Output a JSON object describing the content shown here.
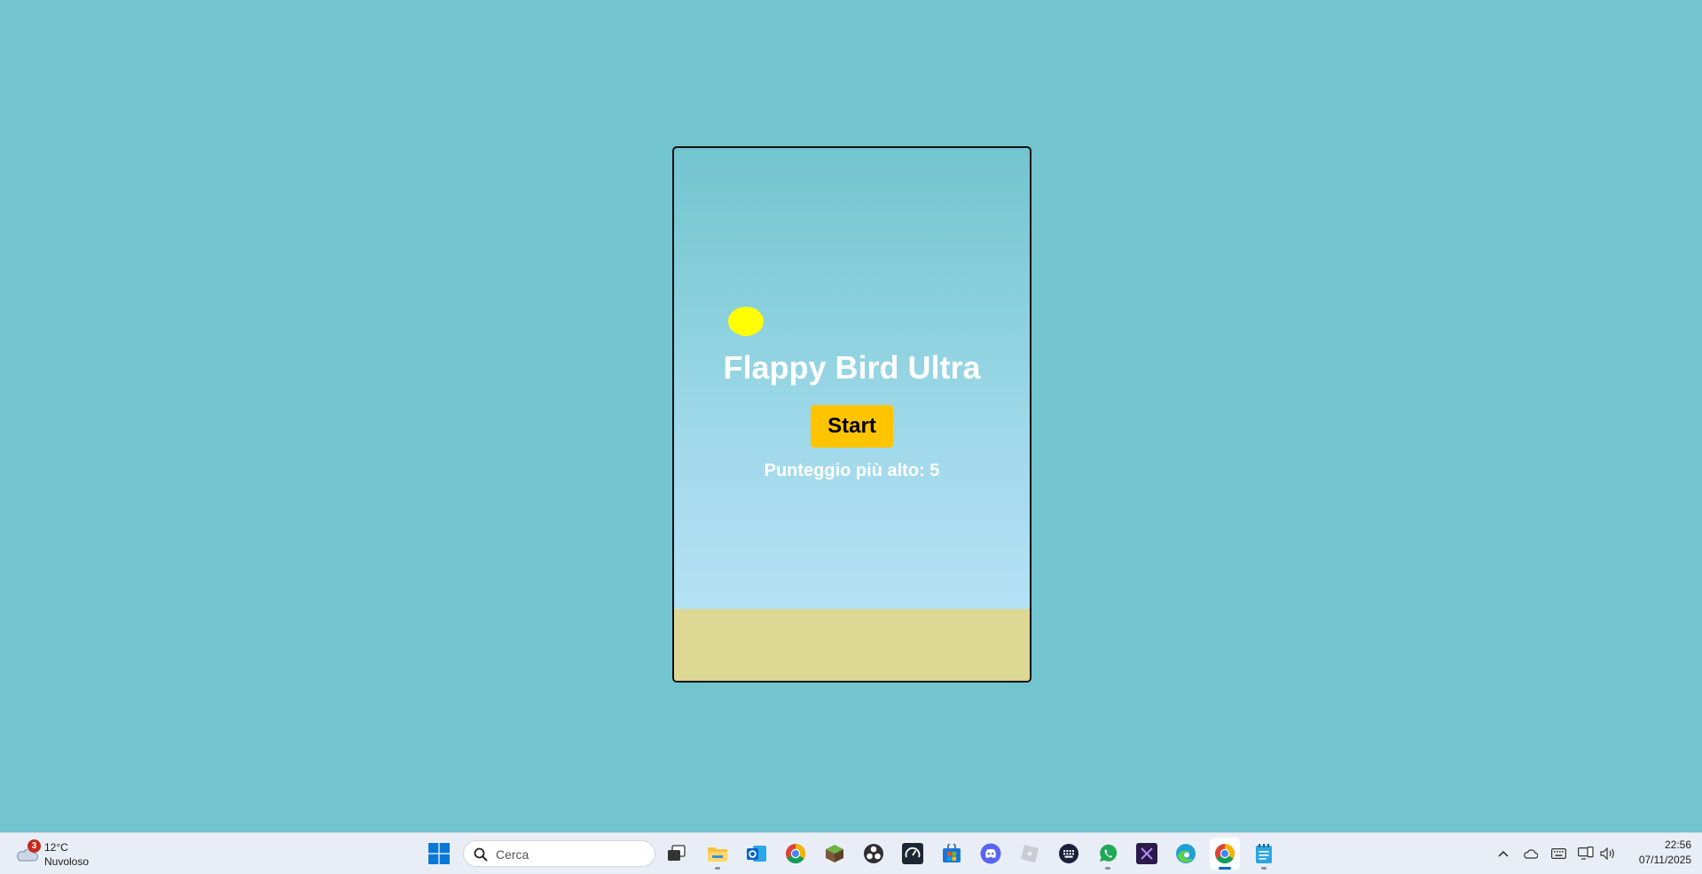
{
  "game": {
    "title": "Flappy Bird Ultra",
    "start_label": "Start",
    "highscore_label": "Punteggio più alto: 5",
    "colors": {
      "ground": "#ded895",
      "bird": "#ffff00",
      "button": "#ffc400",
      "page_bg": "#72c5cf"
    }
  },
  "taskbar": {
    "weather": {
      "badge": "3",
      "temperature": "12°C",
      "condition": "Nuvoloso"
    },
    "search": {
      "placeholder": "Cerca"
    },
    "apps": [
      {
        "name": "task-view-icon"
      },
      {
        "name": "file-explorer-icon"
      },
      {
        "name": "outlook-icon"
      },
      {
        "name": "chrome-icon"
      },
      {
        "name": "minecraft-icon"
      },
      {
        "name": "obs-icon"
      },
      {
        "name": "speedometer-icon"
      },
      {
        "name": "microsoft-store-icon"
      },
      {
        "name": "discord-icon"
      },
      {
        "name": "roblox-icon"
      },
      {
        "name": "keyboard-app-icon"
      },
      {
        "name": "whatsapp-icon"
      },
      {
        "name": "visual-studio-icon"
      },
      {
        "name": "edge-icon"
      },
      {
        "name": "chrome-active-icon"
      },
      {
        "name": "notepad-icon"
      }
    ],
    "tray": [
      "chevron-up-icon",
      "onedrive-icon",
      "keyboard-icon",
      "network-icon",
      "volume-icon"
    ],
    "clock": {
      "time": "22:56",
      "date": "07/11/2025"
    }
  }
}
